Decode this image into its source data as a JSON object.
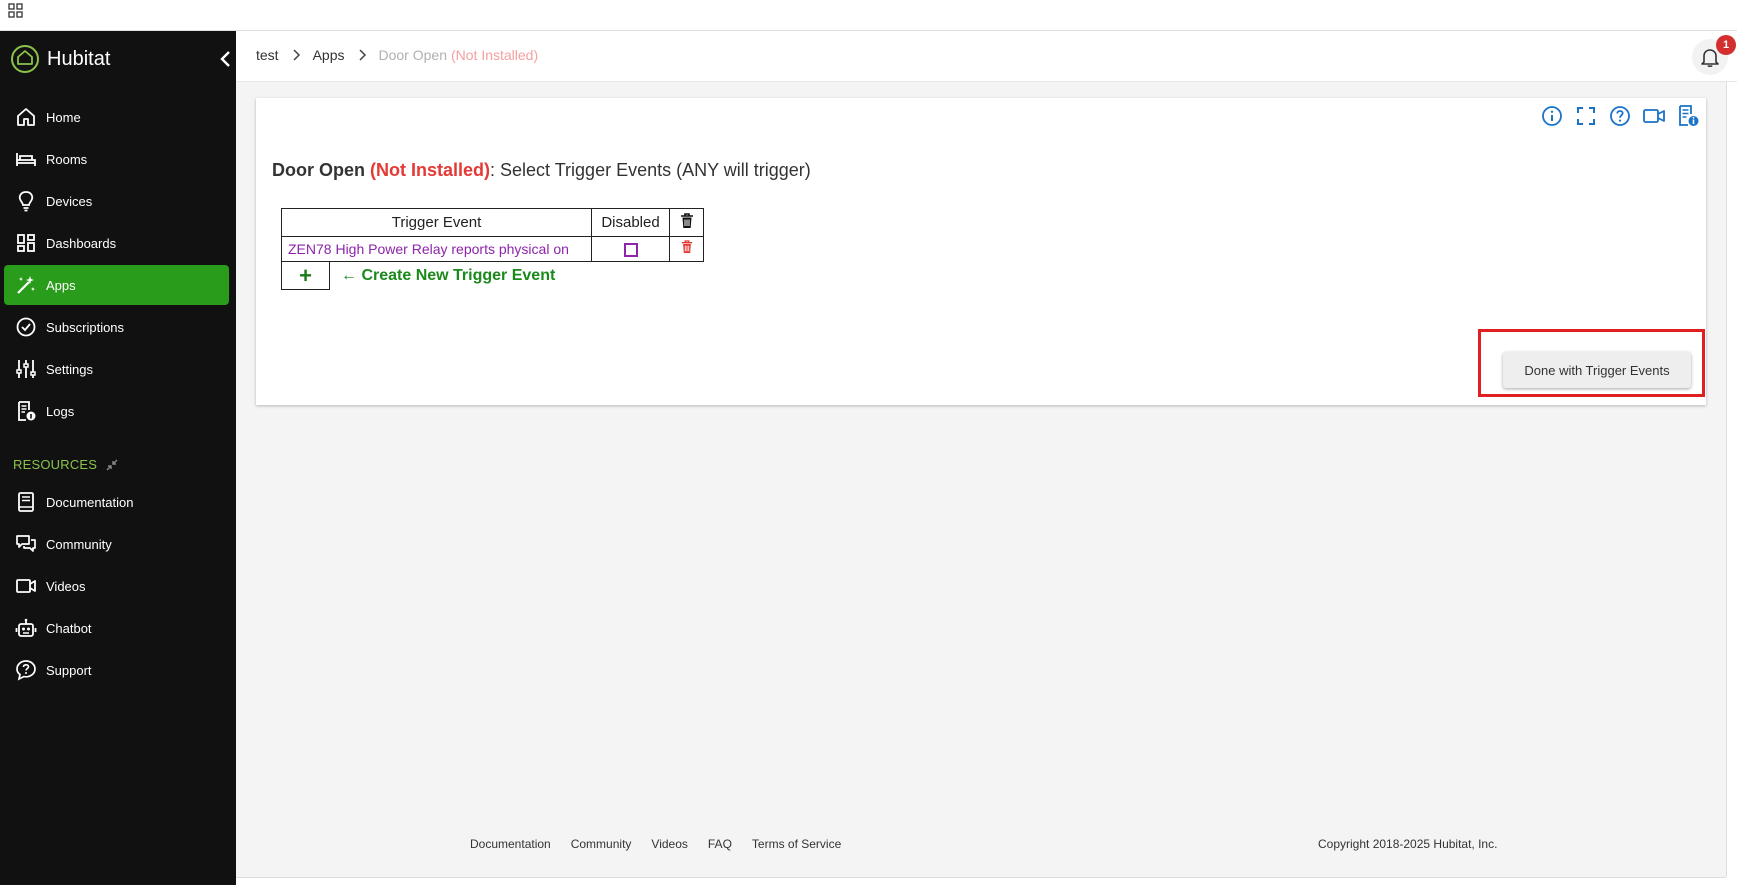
{
  "brand": {
    "name": "Hubitat"
  },
  "sidebar": {
    "items": [
      {
        "label": "Home",
        "icon": "home-icon"
      },
      {
        "label": "Rooms",
        "icon": "bed-icon"
      },
      {
        "label": "Devices",
        "icon": "lightbulb-icon"
      },
      {
        "label": "Dashboards",
        "icon": "dashboard-icon"
      },
      {
        "label": "Apps",
        "icon": "magic-wand-icon",
        "active": true
      },
      {
        "label": "Subscriptions",
        "icon": "check-circle-icon"
      },
      {
        "label": "Settings",
        "icon": "sliders-icon"
      },
      {
        "label": "Logs",
        "icon": "log-icon"
      }
    ],
    "resources_label": "RESOURCES",
    "resources": [
      {
        "label": "Documentation",
        "icon": "book-icon"
      },
      {
        "label": "Community",
        "icon": "chat-icon"
      },
      {
        "label": "Videos",
        "icon": "video-icon"
      },
      {
        "label": "Chatbot",
        "icon": "robot-icon"
      },
      {
        "label": "Support",
        "icon": "help-bubble-icon"
      }
    ]
  },
  "header": {
    "breadcrumb": [
      "test",
      "Apps"
    ],
    "current_app": "Door Open",
    "current_status": "(Not Installed)",
    "notification_count": "1"
  },
  "page": {
    "app_name": "Door Open",
    "status": "(Not Installed)",
    "heading_suffix": ": Select Trigger Events (ANY will trigger)"
  },
  "trigger_table": {
    "headers": {
      "event": "Trigger Event",
      "disabled": "Disabled"
    },
    "rows": [
      {
        "event": "ZEN78 High Power Relay reports physical on",
        "disabled": false
      }
    ]
  },
  "actions": {
    "add_symbol": "+",
    "create_new": "← Create New Trigger Event",
    "done": "Done with Trigger Events"
  },
  "footer": {
    "links": [
      "Documentation",
      "Community",
      "Videos",
      "FAQ",
      "Terms of Service"
    ],
    "copyright": "Copyright 2018-2025 Hubitat, Inc."
  },
  "colors": {
    "sidebar_bg": "#111111",
    "active_green": "#2a9c1c",
    "status_red": "#e53935",
    "link_green": "#1b8a1b",
    "event_purple": "#8e24aa",
    "icon_blue": "#1a73c8",
    "highlight_red": "#e02020"
  }
}
